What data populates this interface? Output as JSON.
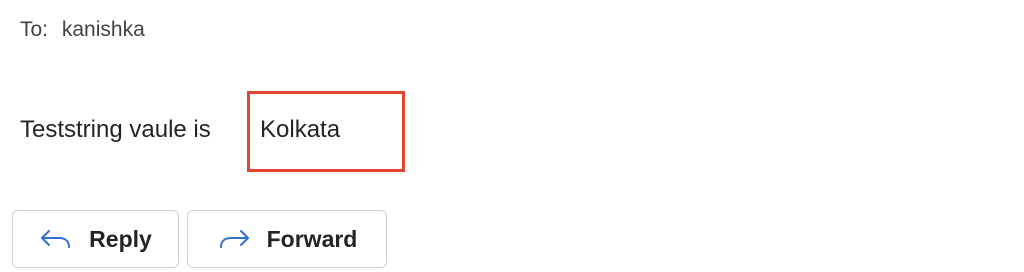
{
  "header": {
    "to_label": "To:",
    "to_value": "kanishka"
  },
  "message": {
    "prefix": "Teststring vaule is",
    "value": "Kolkata"
  },
  "actions": {
    "reply_label": "Reply",
    "reply_icon": "reply-arrow-icon",
    "forward_label": "Forward",
    "forward_icon": "forward-arrow-icon"
  },
  "colors": {
    "highlight_border": "#e2452f",
    "icon_accent": "#2f6fd1",
    "button_border": "#d1d1d1"
  }
}
